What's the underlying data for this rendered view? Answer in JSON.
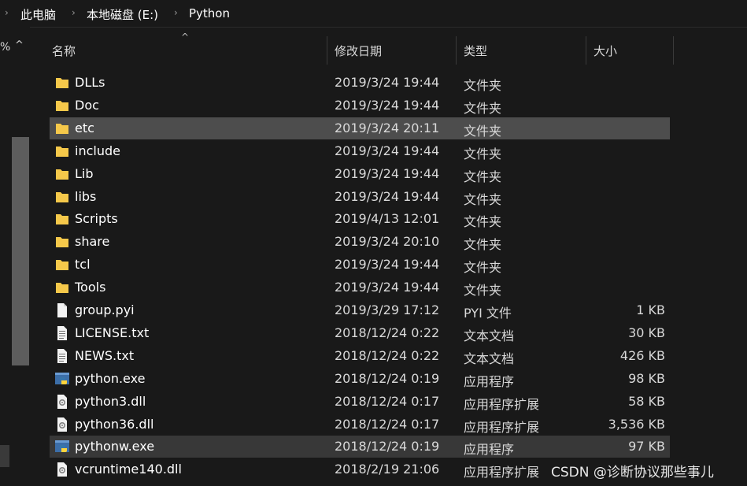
{
  "breadcrumb": {
    "items": [
      "此电脑",
      "本地磁盘 (E:)",
      "Python"
    ]
  },
  "nav": {
    "sort_text": "%",
    "sort_caret": "^"
  },
  "columns": {
    "name": "名称",
    "date": "修改日期",
    "type": "类型",
    "size": "大小",
    "sort_caret": "^"
  },
  "colors": {
    "background": "#191919",
    "folder": "#f5c84a",
    "selected_row": "#4d4d4d",
    "hover_row": "#383838"
  },
  "files": [
    {
      "name": "DLLs",
      "date": "2019/3/24 19:44",
      "type": "文件夹",
      "size": "",
      "icon": "folder-icon",
      "state": ""
    },
    {
      "name": "Doc",
      "date": "2019/3/24 19:44",
      "type": "文件夹",
      "size": "",
      "icon": "folder-icon",
      "state": ""
    },
    {
      "name": "etc",
      "date": "2019/3/24 20:11",
      "type": "文件夹",
      "size": "",
      "icon": "folder-icon",
      "state": "selected"
    },
    {
      "name": "include",
      "date": "2019/3/24 19:44",
      "type": "文件夹",
      "size": "",
      "icon": "folder-icon",
      "state": ""
    },
    {
      "name": "Lib",
      "date": "2019/3/24 19:44",
      "type": "文件夹",
      "size": "",
      "icon": "folder-icon",
      "state": ""
    },
    {
      "name": "libs",
      "date": "2019/3/24 19:44",
      "type": "文件夹",
      "size": "",
      "icon": "folder-icon",
      "state": ""
    },
    {
      "name": "Scripts",
      "date": "2019/4/13 12:01",
      "type": "文件夹",
      "size": "",
      "icon": "folder-icon",
      "state": ""
    },
    {
      "name": "share",
      "date": "2019/3/24 20:10",
      "type": "文件夹",
      "size": "",
      "icon": "folder-icon",
      "state": ""
    },
    {
      "name": "tcl",
      "date": "2019/3/24 19:44",
      "type": "文件夹",
      "size": "",
      "icon": "folder-icon",
      "state": ""
    },
    {
      "name": "Tools",
      "date": "2019/3/24 19:44",
      "type": "文件夹",
      "size": "",
      "icon": "folder-icon",
      "state": ""
    },
    {
      "name": "group.pyi",
      "date": "2019/3/29 17:12",
      "type": "PYI 文件",
      "size": "1 KB",
      "icon": "blank-file-icon",
      "state": ""
    },
    {
      "name": "LICENSE.txt",
      "date": "2018/12/24 0:22",
      "type": "文本文档",
      "size": "30 KB",
      "icon": "text-file-icon",
      "state": ""
    },
    {
      "name": "NEWS.txt",
      "date": "2018/12/24 0:22",
      "type": "文本文档",
      "size": "426 KB",
      "icon": "text-file-icon",
      "state": ""
    },
    {
      "name": "python.exe",
      "date": "2018/12/24 0:19",
      "type": "应用程序",
      "size": "98 KB",
      "icon": "python-exe-icon",
      "state": ""
    },
    {
      "name": "python3.dll",
      "date": "2018/12/24 0:17",
      "type": "应用程序扩展",
      "size": "58 KB",
      "icon": "dll-file-icon",
      "state": ""
    },
    {
      "name": "python36.dll",
      "date": "2018/12/24 0:17",
      "type": "应用程序扩展",
      "size": "3,536 KB",
      "icon": "dll-file-icon",
      "state": ""
    },
    {
      "name": "pythonw.exe",
      "date": "2018/12/24 0:19",
      "type": "应用程序",
      "size": "97 KB",
      "icon": "python-exe-icon",
      "state": "hover"
    },
    {
      "name": "vcruntime140.dll",
      "date": "2018/2/19 21:06",
      "type": "应用程序扩展",
      "size": "",
      "icon": "dll-file-icon",
      "state": ""
    }
  ],
  "watermark": "CSDN @诊断协议那些事儿"
}
